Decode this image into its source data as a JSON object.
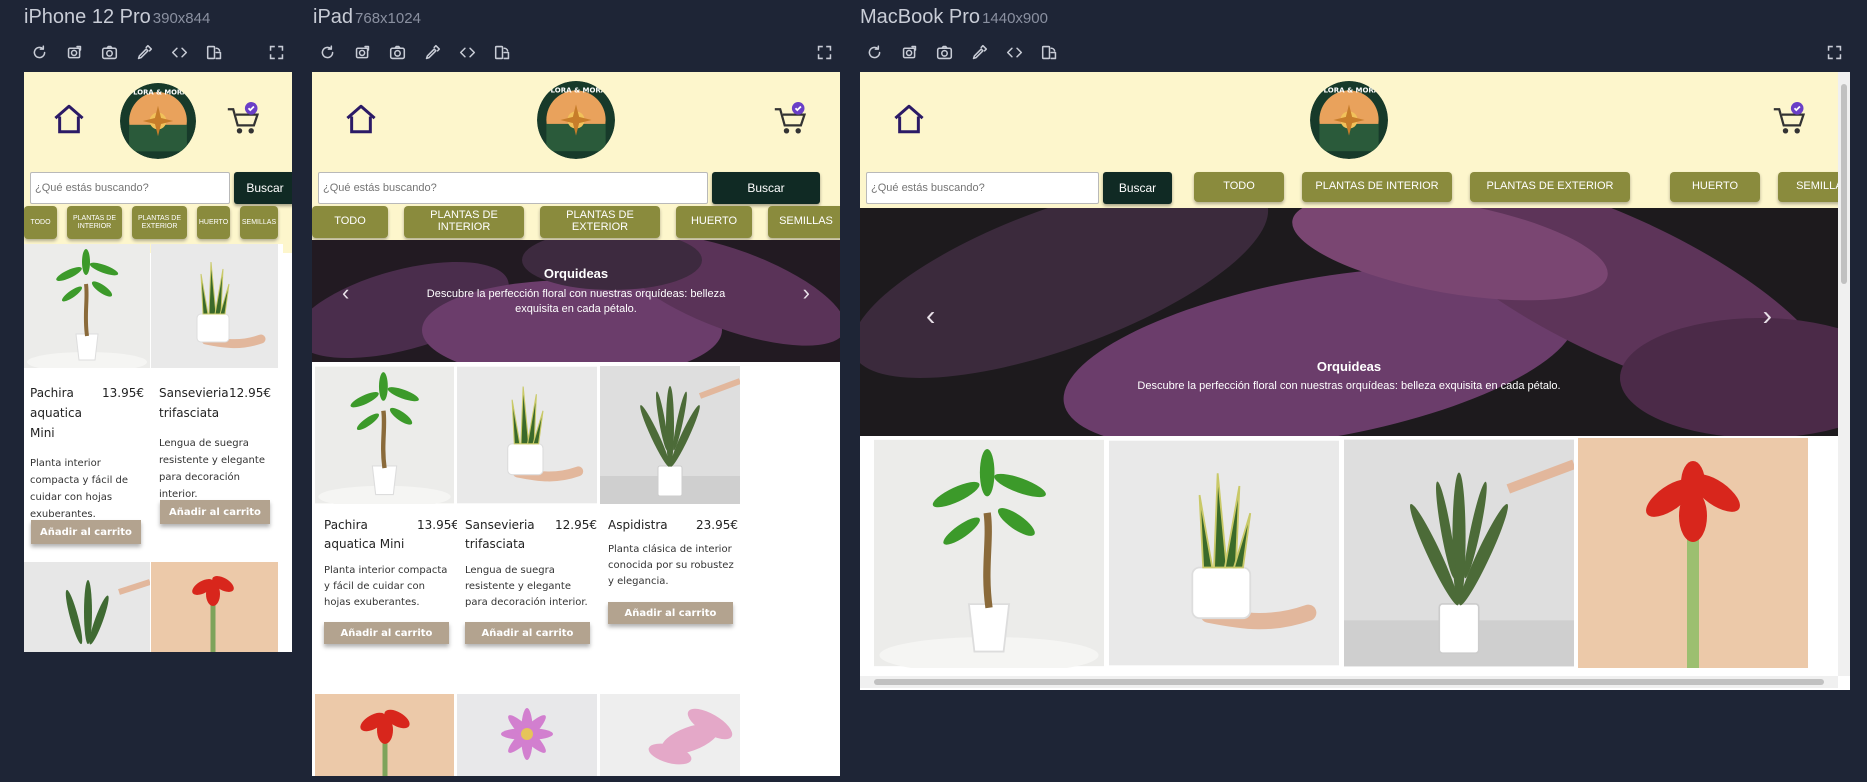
{
  "devices": [
    {
      "name": "iPhone 12 Pro",
      "size": "390x844"
    },
    {
      "name": "iPad",
      "size": "768x1024"
    },
    {
      "name": "MacBook Pro",
      "size": "1440x900"
    }
  ],
  "toolbar": {
    "icons": [
      "reload-icon",
      "screenshot-full-icon",
      "camera-icon",
      "eyedropper-icon",
      "code-icon",
      "rotate-icon"
    ],
    "expand_icon": "expand-icon"
  },
  "site": {
    "logo_text": "FLORA & MORA",
    "search_placeholder": "¿Qué estás buscando?",
    "search_button": "Buscar",
    "categories": [
      "TODO",
      "PLANTAS DE INTERIOR",
      "PLANTAS DE EXTERIOR",
      "HUERTO",
      "SEMILLAS"
    ],
    "banner": {
      "title": "Orquideas",
      "text": "Descubre la perfección floral con nuestras orquídeas: belleza exquisita en cada pétalo."
    },
    "add_to_cart": "Añadir al carrito",
    "products": [
      {
        "name": "Pachira aquatica Mini",
        "price": "13.95€",
        "desc": "Planta interior compacta y fácil de cuidar con hojas exuberantes."
      },
      {
        "name": "Sansevieria trifasciata",
        "price": "12.95€",
        "desc": "Lengua de suegra resistente y elegante para decoración interior."
      },
      {
        "name": "Aspidistra",
        "price": "23.95€",
        "desc": "Planta clásica de interior conocida por su robustez y elegancia."
      }
    ]
  },
  "colors": {
    "header_bg": "#fdf6cc",
    "category_bg": "#8a8b3d",
    "search_button_bg": "#102a24",
    "add_button_bg": "#b3a38f",
    "frame_bg": "#1e2536"
  }
}
